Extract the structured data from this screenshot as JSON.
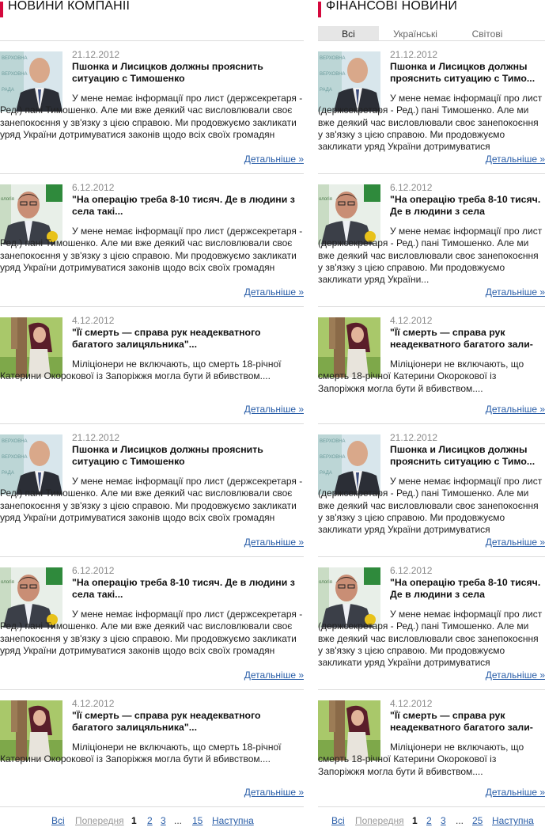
{
  "left": {
    "title": "НОВИНИ КОМПАНІЇ",
    "items": [
      {
        "date": "21.12.2012",
        "title": "Пшонка и Лисицков должны прояснить ситуацию с Тимошенко",
        "summary": "У мене немає інформації про лист (держсекретаря - Ред.) пані Тимошенко. Але ми вже деякий час висловлювали своє занепокоєння у зв'язку з цією справою. Ми продовжуємо закликати уряд України дотримуватися законів щодо всіх своїх громадян",
        "more": "Детальніше »",
        "photo": "bald-man"
      },
      {
        "date": "6.12.2012",
        "title": "\"На операцію треба 8-10 тисяч. Де в людини з села такі...",
        "summary": "У мене немає інформації про лист (держсекретаря - Ред.) пані Тимошенко. Але ми вже деякий час висловлювали своє занепокоєння у зв'язку з цією справою. Ми продовжуємо закликати уряд України дотримуватися законів щодо всіх своїх громадян",
        "more": "Детальніше »",
        "photo": "man-glasses"
      },
      {
        "date": "4.12.2012",
        "title": "\"Її смерть — справа рук неадекватного багатого залицяльника\"...",
        "summary": "Міліціонери не включають, що смерть 18-річної Катерини Окорокової із Запоріжжя могла бути й вбивством....",
        "more": "Детальніше »",
        "photo": "woman-tree"
      },
      {
        "date": "21.12.2012",
        "title": "Пшонка и Лисицков должны прояснить ситуацию с Тимошенко",
        "summary": "У мене немає інформації про лист (держсекретаря - Ред.) пані Тимошенко. Але ми вже деякий час висловлювали своє занепокоєння у зв'язку з цією справою. Ми продовжуємо закликати уряд України дотримуватися законів щодо всіх своїх громадян",
        "more": "Детальніше »",
        "photo": "bald-man"
      },
      {
        "date": "6.12.2012",
        "title": "\"На операцію треба 8-10 тисяч. Де в людини з села такі...",
        "summary": "У мене немає інформації про лист (держсекретаря - Ред.) пані Тимошенко. Але ми вже деякий час висловлювали своє занепокоєння у зв'язку з цією справою. Ми продовжуємо закликати уряд України дотримуватися законів щодо всіх своїх громадян",
        "more": "Детальніше »",
        "photo": "man-glasses"
      },
      {
        "date": "4.12.2012",
        "title": "\"Її смерть — справа рук неадекватного багатого залицяльника\"...",
        "summary": "Міліціонери не включають, що смерть 18-річної Катерини Окорокової із Запоріжжя могла бути й вбивством....",
        "more": "Детальніше »",
        "photo": "woman-tree"
      }
    ],
    "pagination": {
      "all": "Всі",
      "prev": "Попередня",
      "p1": "1",
      "p2": "2",
      "p3": "3",
      "dots": "...",
      "last": "15",
      "next": "Наступна"
    }
  },
  "right": {
    "title": "ФІНАНСОВІ НОВИНИ",
    "tabs": [
      "Всі",
      "Українські",
      "Світові"
    ],
    "active_tab": "Всі",
    "items": [
      {
        "date": "21.12.2012",
        "title": "Пшонка и Лисицков должны прояснить ситуацию с Тимо...",
        "summary": "У мене немає інформації про лист (держсекретаря - Ред.) пані Тимошенко. Але ми вже деякий час висловлювали своє занепокоєння у зв'язку з цією справою. Ми продовжуємо закликати уряд України дотримуватися",
        "more": "Детальніше »",
        "photo": "bald-man"
      },
      {
        "date": "6.12.2012",
        "title": "\"На операцію треба 8-10 тисяч. Де в людини з села",
        "summary": "У мене немає інформації про лист (держсекретаря - Ред.) пані Тимошенко. Але ми вже деякий час висловлювали своє занепокоєння у зв'язку з цією справою. Ми продовжуємо закликати уряд України...",
        "more": "Детальніше »",
        "photo": "man-glasses"
      },
      {
        "date": "4.12.2012",
        "title": "\"Її смерть — справа рук неадекватного багатого зали-",
        "summary": "Міліціонери не включають, що смерть 18-річної Катерини Окорокової із Запоріжжя могла бути й вбивством....",
        "more": "Детальніше »",
        "photo": "woman-tree"
      },
      {
        "date": "21.12.2012",
        "title": "Пшонка и Лисицков должны прояснить ситуацию с Тимо...",
        "summary": "У мене немає інформації про лист (держсекретаря - Ред.) пані Тимошенко. Але ми вже деякий час висловлювали своє занепокоєння у зв'язку з цією справою. Ми продовжуємо закликати уряд України дотримуватися",
        "more": "Детальніше »",
        "photo": "bald-man"
      },
      {
        "date": "6.12.2012",
        "title": "\"На операцію треба 8-10 тисяч. Де в людини з села",
        "summary": "У мене немає інформації про лист (держсекретаря - Ред.) пані Тимошенко. Але ми вже деякий час висловлювали своє занепокоєння у зв'язку з цією справою. Ми продовжуємо закликати уряд України дотримуватися",
        "more": "Детальніше »",
        "photo": "man-glasses"
      },
      {
        "date": "4.12.2012",
        "title": "\"Її смерть — справа рук неадекватного багатого зали-",
        "summary": "Міліціонери не включають, що смерть 18-річної Катерини Окорокової із Запоріжжя могла бути й вбивством....",
        "more": "Детальніше »",
        "photo": "woman-tree"
      }
    ],
    "pagination": {
      "all": "Всі",
      "prev": "Попередня",
      "p1": "1",
      "p2": "2",
      "p3": "3",
      "dots": "...",
      "last": "25",
      "next": "Наступна"
    }
  },
  "colors": {
    "accent": "#d4093d",
    "link": "#2a5ea8",
    "date": "#8a8a8a",
    "separator": "#dcdcdc",
    "tab_active_bg": "#e6e6e6"
  }
}
